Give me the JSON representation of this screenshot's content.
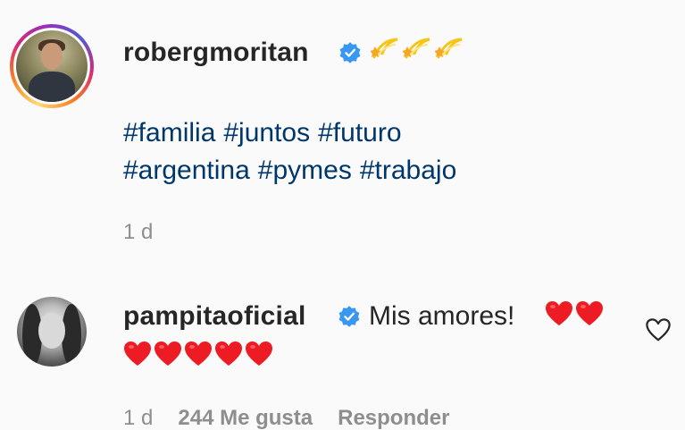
{
  "post": {
    "username": "robergmoritan",
    "verified": true,
    "emoji": [
      "dizzy-emoji",
      "dizzy-emoji",
      "dizzy-emoji"
    ],
    "hashtags_line1": [
      "#familia",
      "#juntos",
      "#futuro"
    ],
    "hashtags_line2": [
      "#argentina",
      "#pymes",
      "#trabajo"
    ],
    "time": "1 d"
  },
  "comment": {
    "username": "pampitaoficial",
    "verified": true,
    "text": "Mis amores!",
    "hearts_inline": 2,
    "hearts_next_line": 5,
    "time": "1 d",
    "likes": "244 Me gusta",
    "reply_label": "Responder",
    "like_icon": "heart-outline-icon"
  },
  "colors": {
    "hashtag": "#00376b",
    "verified": "#3897f0",
    "muted": "#8e8e8e",
    "heart": "#ed1c24"
  }
}
